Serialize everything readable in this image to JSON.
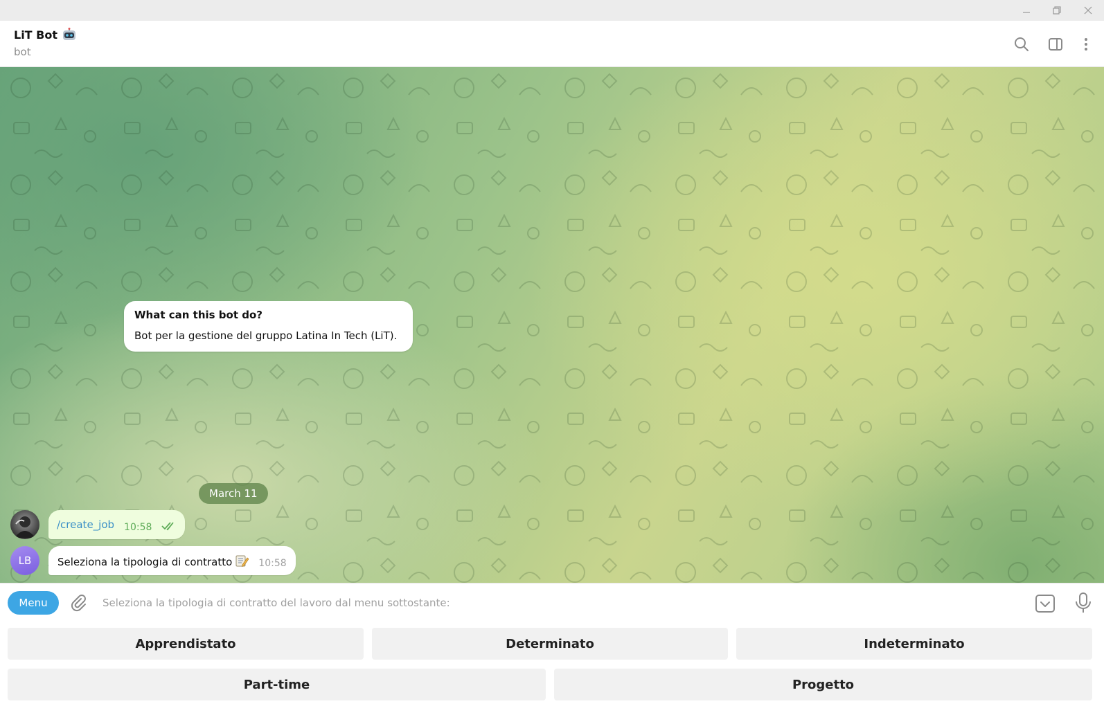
{
  "window": {
    "controls": [
      "minimize-icon",
      "restore-icon",
      "close-icon"
    ]
  },
  "header": {
    "title": "LiT Bot",
    "title_emoji": "robot-icon",
    "subtitle": "bot",
    "actions": [
      "search-icon",
      "sidebar-toggle-icon",
      "more-vertical-icon"
    ]
  },
  "chat": {
    "bot_info": {
      "title": "What can this bot do?",
      "text": "Bot per la gestione del gruppo Latina In Tech (LiT)."
    },
    "date_separator": "March 11",
    "messages": [
      {
        "direction": "out",
        "text": "/create_job",
        "time": "10:58",
        "status": "read"
      },
      {
        "direction": "in",
        "avatar_initials": "LB",
        "text": "Seleziona la tipologia di contratto",
        "time": "10:58"
      }
    ]
  },
  "composer": {
    "menu_label": "Menu",
    "placeholder": "Seleziona la tipologia di contratto del lavoro dal menu sottostante:",
    "value": ""
  },
  "keyboard": {
    "row1": [
      "Apprendistato",
      "Determinato",
      "Indeterminato"
    ],
    "row2": [
      "Part-time",
      "Progetto"
    ]
  },
  "colors": {
    "accent": "#3da6e4",
    "outgoing_bubble": "#effdde",
    "outgoing_time": "#5dab57",
    "link": "#3a8fc7"
  }
}
